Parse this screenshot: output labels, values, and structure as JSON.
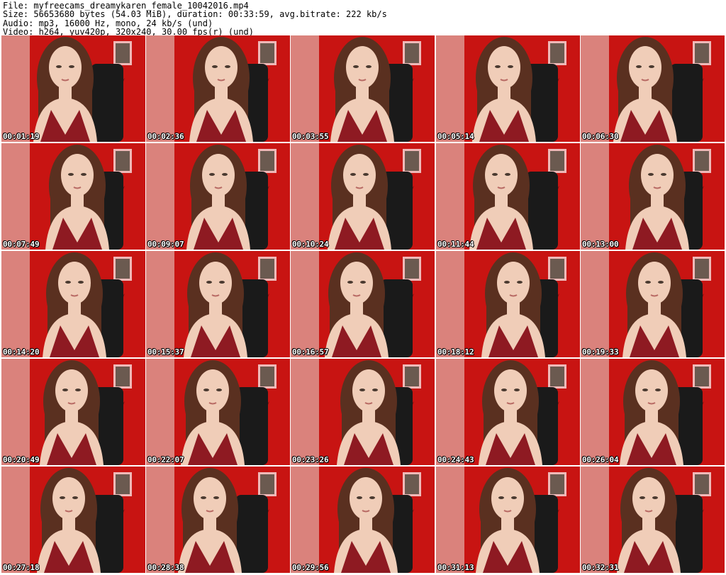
{
  "header": {
    "line1": "File: myfreecams_dreamykaren_female_10042016.mp4",
    "line2": "Size: 56653680 bytes (54.03 MiB), duration: 00:33:59, avg.bitrate: 222 kb/s",
    "line3": "Audio: mp3, 16000 Hz, mono, 24 kb/s (und)",
    "line4": "Video: h264, yuv420p, 320x240, 30.00 fps(r) (und)"
  },
  "thumbnails": [
    {
      "timestamp": "00:01:19"
    },
    {
      "timestamp": "00:02:36"
    },
    {
      "timestamp": "00:03:55"
    },
    {
      "timestamp": "00:05:14"
    },
    {
      "timestamp": "00:06:30"
    },
    {
      "timestamp": "00:07:49"
    },
    {
      "timestamp": "00:09:07"
    },
    {
      "timestamp": "00:10:24"
    },
    {
      "timestamp": "00:11:44"
    },
    {
      "timestamp": "00:13:00"
    },
    {
      "timestamp": "00:14:20"
    },
    {
      "timestamp": "00:15:37"
    },
    {
      "timestamp": "00:16:57"
    },
    {
      "timestamp": "00:18:12"
    },
    {
      "timestamp": "00:19:33"
    },
    {
      "timestamp": "00:20:49"
    },
    {
      "timestamp": "00:22:07"
    },
    {
      "timestamp": "00:23:26"
    },
    {
      "timestamp": "00:24:43"
    },
    {
      "timestamp": "00:26:04"
    },
    {
      "timestamp": "00:27:18"
    },
    {
      "timestamp": "00:28:38"
    },
    {
      "timestamp": "00:29:56"
    },
    {
      "timestamp": "00:31:13"
    },
    {
      "timestamp": "00:32:31"
    }
  ],
  "colors": {
    "wall_red": "#c81412",
    "dress": "#8e1a22",
    "hair": "#5a3020",
    "skin": "#f0cdb8",
    "curtain": "#e9ddd4",
    "chair": "#1a1a1a"
  }
}
